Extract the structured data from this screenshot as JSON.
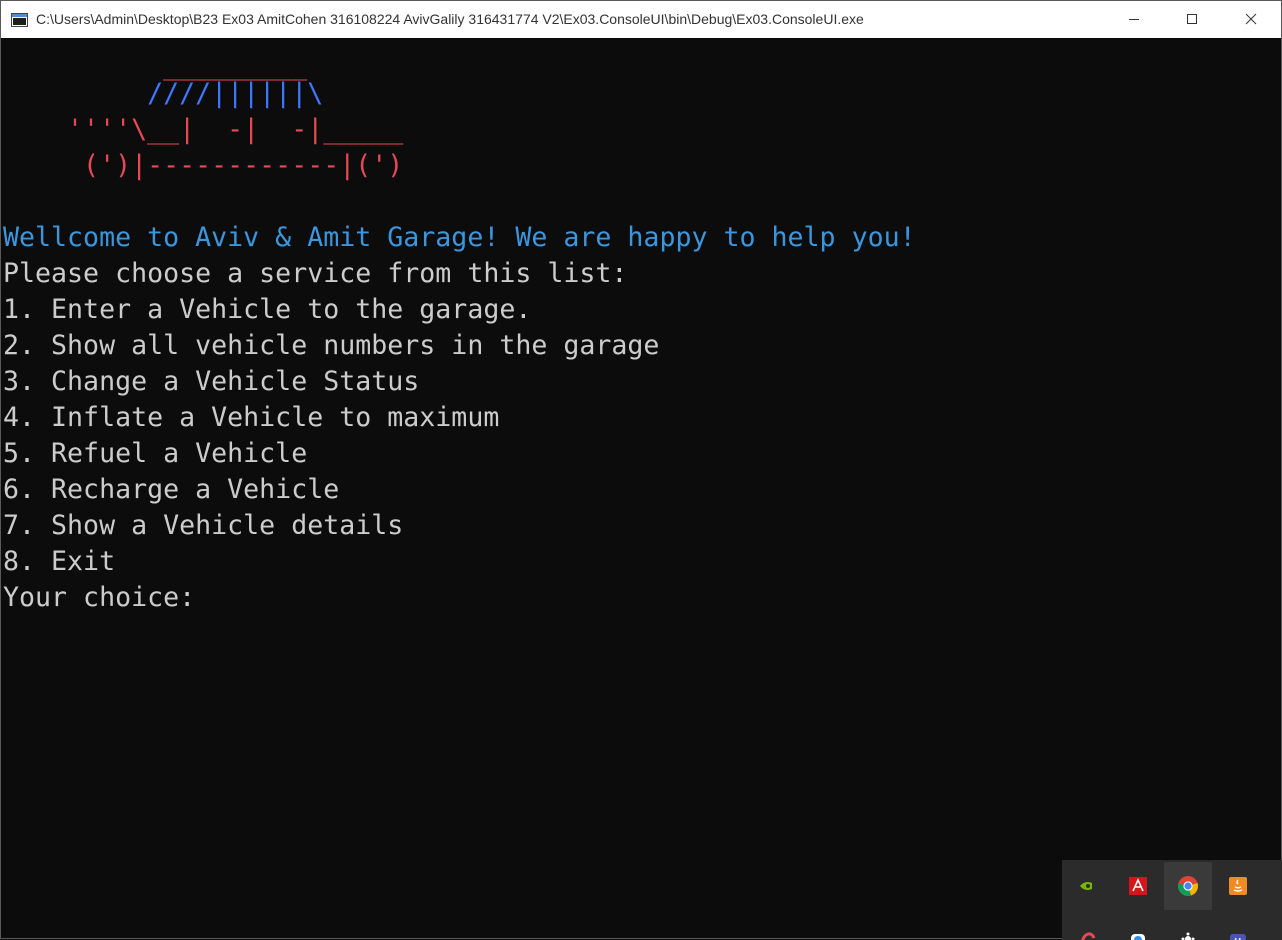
{
  "window": {
    "title": "C:\\Users\\Admin\\Desktop\\B23 Ex03 AmitCohen 316108224 AvivGalily 316431774 V2\\Ex03.ConsoleUI\\bin\\Debug\\Ex03.ConsoleUI.exe",
    "minimize_icon": "minimize-icon",
    "maximize_icon": "maximize-icon",
    "close_icon": "close-icon"
  },
  "ascii_art": {
    "line1": "          _________",
    "line2": "         ////||||||\\",
    "line3": "    ''''\\__|  -|  -|_____",
    "line4": "     (')|------------|(')",
    "roof_color": "#e74856",
    "top_color": "#3b78ff",
    "body_color": "#e74856"
  },
  "console": {
    "welcome": "Wellcome to Aviv & Amit Garage! We are happy to help you!",
    "welcome_color": "#3a96dd",
    "prompt": "Please choose a service from this list:",
    "menu": [
      "1. Enter a Vehicle to the garage.",
      "2. Show all vehicle numbers in the garage",
      "3. Change a Vehicle Status",
      "4. Inflate a Vehicle to maximum",
      "5. Refuel a Vehicle",
      "6. Recharge a Vehicle",
      "7. Show a Vehicle details",
      "8. Exit"
    ],
    "choice_prompt": "Your choice:",
    "text_color": "#cccccc"
  },
  "tray": {
    "icons": [
      "nvidia-icon",
      "adobe-acrobat-icon",
      "chrome-icon",
      "java-icon",
      "onedrive-partial-icon",
      "slack-partial-icon",
      "app-partial-icon",
      "teams-partial-icon"
    ]
  }
}
